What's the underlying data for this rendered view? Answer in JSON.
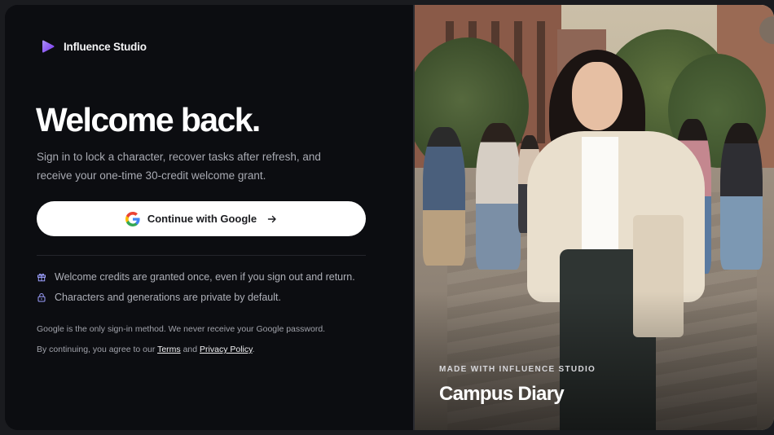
{
  "brand": {
    "name": "Influence Studio",
    "icon": "play-triangle-logo",
    "accent": "#8b5cf6"
  },
  "hero": {
    "title": "Welcome back.",
    "subtitle": "Sign in to lock a character, recover tasks after refresh, and receive your one-time 30-credit welcome grant."
  },
  "signin": {
    "google_label": "Continue with Google",
    "google_icon": "google-icon",
    "arrow_icon": "arrow-right-icon"
  },
  "features": [
    {
      "icon": "gift-icon",
      "text": "Welcome credits are granted once, even if you sign out and return."
    },
    {
      "icon": "lock-icon",
      "text": "Characters and generations are private by default."
    }
  ],
  "notes": {
    "google_only": "Google is the only sign-in method. We never receive your Google password.",
    "agree_prefix": "By continuing, you agree to our ",
    "terms": "Terms",
    "and": " and ",
    "privacy": "Privacy Policy",
    "suffix": "."
  },
  "showcase": {
    "eyebrow": "MADE WITH INFLUENCE STUDIO",
    "title": "Campus Diary"
  }
}
